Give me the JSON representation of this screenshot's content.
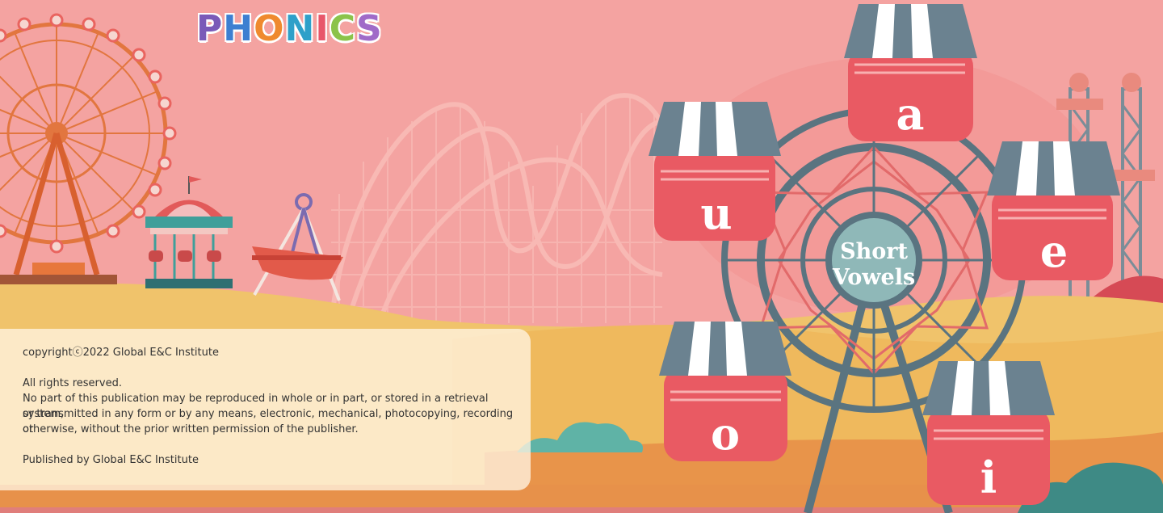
{
  "logo": {
    "letters": [
      "P",
      "H",
      "O",
      "N",
      "I",
      "C",
      "S"
    ],
    "colors": [
      "#7a5ab8",
      "#3d7fd1",
      "#ef8a2e",
      "#2ea0c9",
      "#e8566a",
      "#8bc34a",
      "#a06ac8"
    ]
  },
  "hub": {
    "line1": "Short",
    "line2": "Vowels"
  },
  "vowels": {
    "a": "a",
    "u": "u",
    "e": "e",
    "o": "o",
    "i": "i"
  },
  "copyright": {
    "line1": "copyrightⓒ2022 Global E&C Institute",
    "rights": "All rights reserved.",
    "body1": "No part of this publication may be reproduced in whole or in part, or stored in a retrieval system,",
    "body2": "or transmitted in any form or by any means, electronic, mechanical, photocopying, recording or",
    "body3": "otherwise, without the prior written permission of the publisher.",
    "published": "Published by Global E&C Institute"
  },
  "colors": {
    "bg": "#f4a3a1",
    "gondola": "#e95a63",
    "awning": "#6b8290",
    "hub": "#8fb8b8",
    "wheel": "#5a7480"
  }
}
